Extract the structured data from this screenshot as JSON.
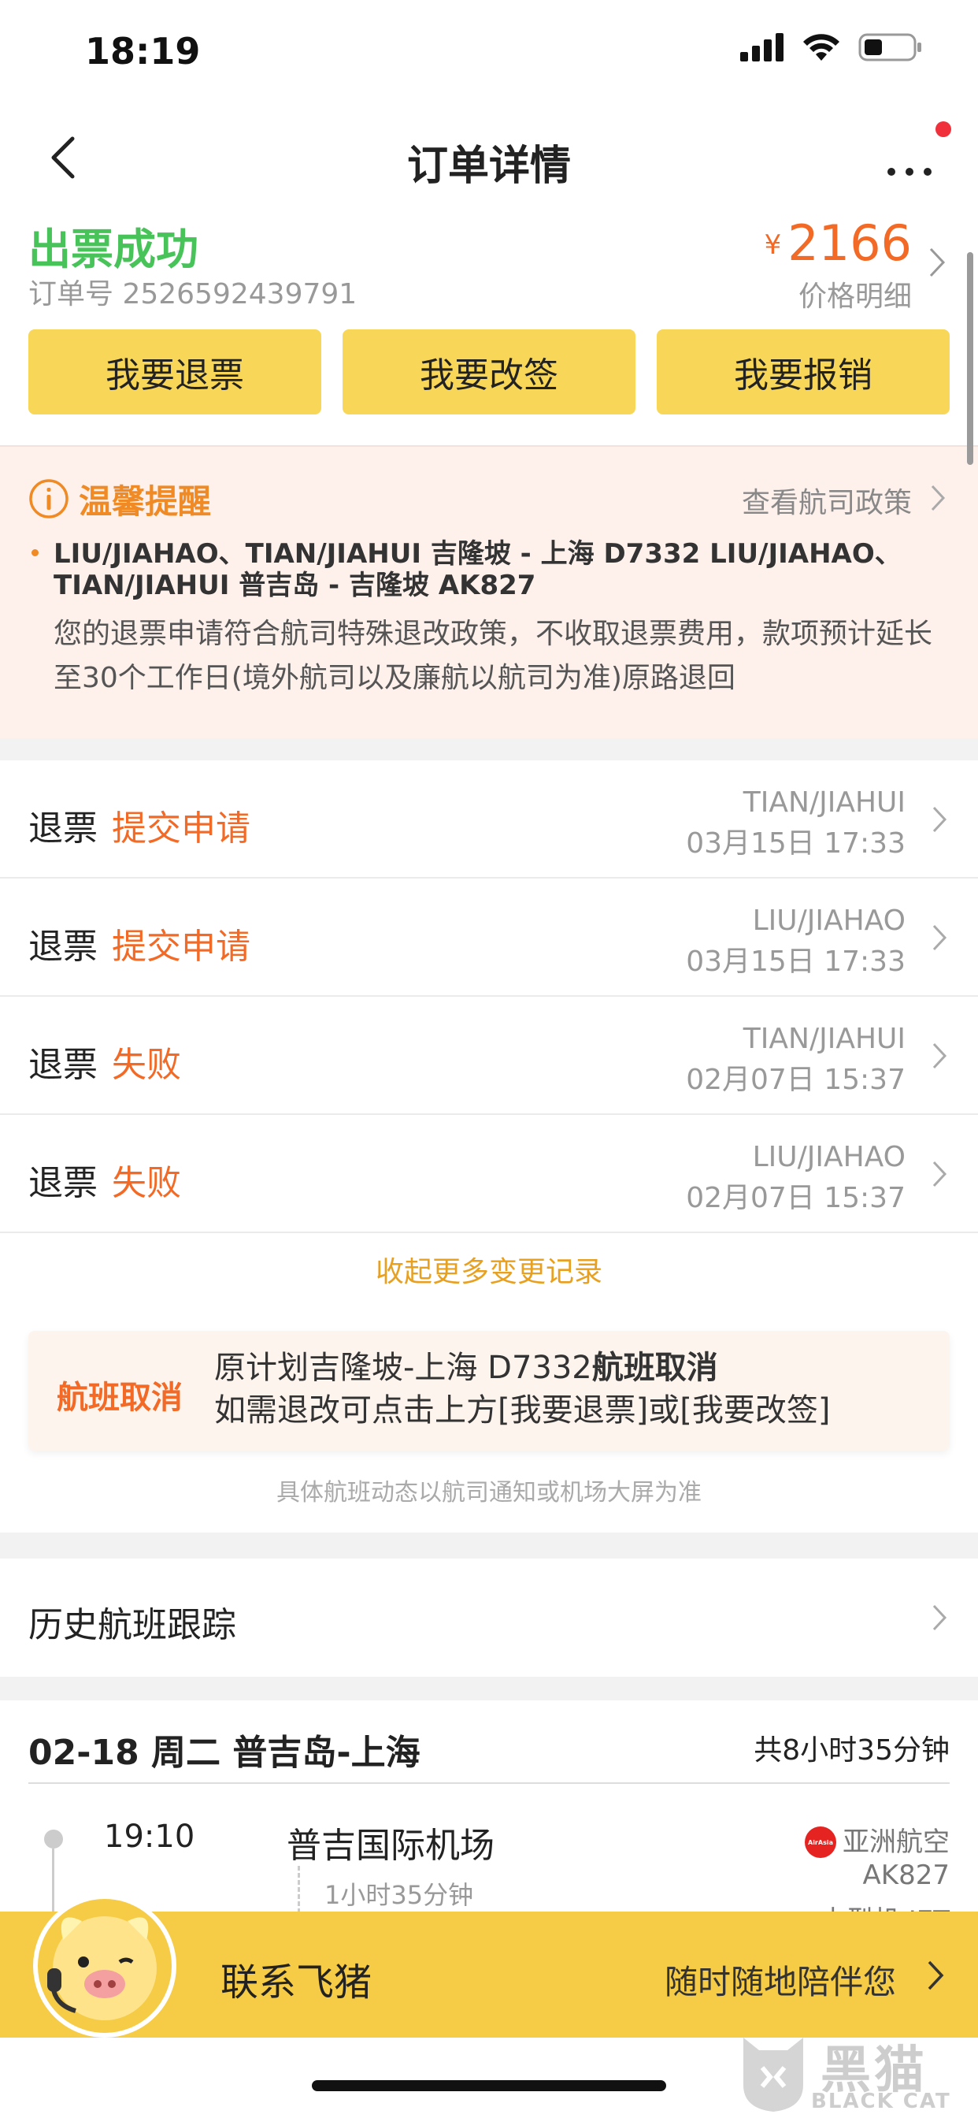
{
  "status_bar": {
    "time": "18:19"
  },
  "nav": {
    "title": "订单详情",
    "back_icon": "chevron-left-icon",
    "more_icon": "more-dots-icon"
  },
  "order": {
    "status": "出票成功",
    "order_no": "订单号 2526592439791",
    "currency": "¥",
    "price": "2166",
    "price_detail": "价格明细",
    "buttons": [
      {
        "label": "我要退票"
      },
      {
        "label": "我要改签"
      },
      {
        "label": "我要报销"
      }
    ]
  },
  "notice": {
    "title": "温馨提醒",
    "link": "查看航司政策",
    "passengers": "LIU/JIAHAO、TIAN/JIAHUI 吉隆坡 - 上海 D7332 LIU/JIAHAO、TIAN/JIAHUI 普吉岛 - 吉隆坡 AK827",
    "body": "您的退票申请符合航司特殊退改政策，不收取退票费用，款项预计延长至30个工作日(境外航司以及廉航以航司为准)原路退回"
  },
  "records": [
    {
      "type": "退票",
      "state": "提交申请",
      "name": "TIAN/JIAHUI",
      "time": "03月15日 17:33"
    },
    {
      "type": "退票",
      "state": "提交申请",
      "name": "LIU/JIAHAO",
      "time": "03月15日 17:33"
    },
    {
      "type": "退票",
      "state": "失败",
      "name": "TIAN/JIAHUI",
      "time": "02月07日 15:37"
    },
    {
      "type": "退票",
      "state": "失败",
      "name": "LIU/JIAHAO",
      "time": "02月07日 15:37"
    }
  ],
  "collapse_link": "收起更多变更记录",
  "cancel": {
    "title": "航班取消",
    "line1_prefix": "原计划吉隆坡-上海 D7332",
    "line1_bold": "航班取消",
    "line2": "如需退改可点击上方[我要退票]或[我要改签]",
    "footnote": "具体航班动态以航司通知或机场大屏为准"
  },
  "history": {
    "label": "历史航班跟踪"
  },
  "flight": {
    "header": "02-18 周二 普吉岛-上海",
    "total": "共8小时35分钟",
    "dep_time": "19:10",
    "dep_airport": "普吉国际机场",
    "duration": "1小时35分钟",
    "airline": "亚洲航空",
    "airline_logo_text": "AirAsia",
    "flight_no": "AK827",
    "aircraft": "中型机 JET"
  },
  "contact": {
    "label": "联系飞猪",
    "slogan": "随时随地陪伴您"
  },
  "watermark": {
    "title": "黑猫",
    "subtitle": "BLACK CAT"
  }
}
